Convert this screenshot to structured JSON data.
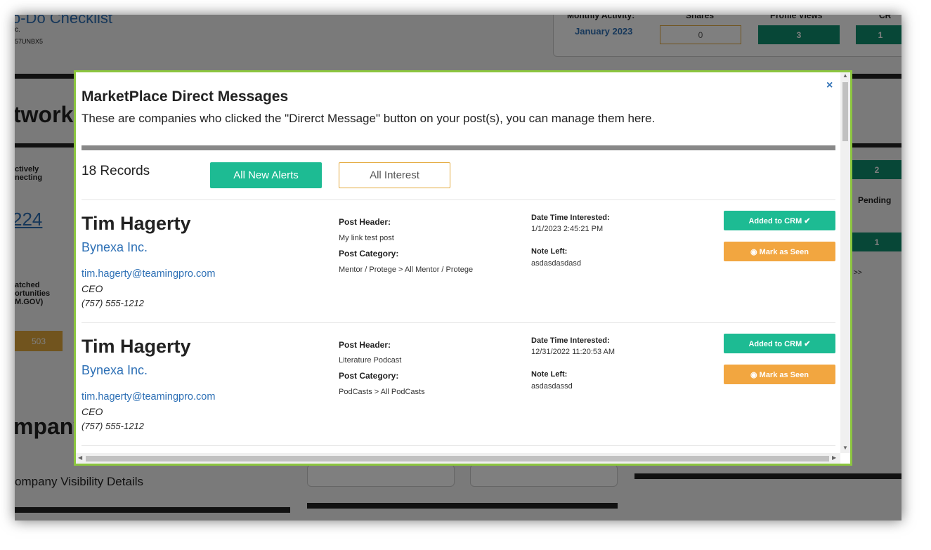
{
  "background": {
    "checklist_title": "o-Do Checklist",
    "company_fragment": "c.",
    "code_fragment": "57UNBX5",
    "monthly_activity_label": "Monthly Activity:",
    "month": "January 2023",
    "shares_label": "Shares",
    "profile_views_label": "Profile Views",
    "crm_label": "CR",
    "shares_value": "0",
    "profile_views_value": "3",
    "crm_value": "1",
    "networking_fragment": "tworki",
    "actively_connecting": "ctively\nnecting",
    "big_number": "224",
    "matched_opps": "atched\nortunities\nM.GOV)",
    "orange_value": "503",
    "company_fragment2": "mpany",
    "visibility_details": "ompany Visibility Details",
    "pending_label": "Pending",
    "right_green_1": "2",
    "right_green_2": "1",
    "arrows": ">>"
  },
  "modal": {
    "title": "MarketPlace Direct Messages",
    "subtitle": "These are companies who clicked the \"Direrct Message\" button on your post(s), you can manage them here.",
    "close_symbol": "×",
    "records_count": "18 Records",
    "tab_new_alerts": "All New Alerts",
    "tab_all_interest": "All Interest",
    "labels": {
      "post_header": "Post Header:",
      "post_category": "Post Category:",
      "date_time": "Date Time Interested:",
      "note_left": "Note Left:"
    },
    "records": [
      {
        "name": "Tim Hagerty",
        "company": "Bynexa Inc.",
        "email": "tim.hagerty@teamingpro.com",
        "title": "CEO",
        "phone": "(757) 555-1212",
        "post_header": "My link test post",
        "post_category": "Mentor / Protege > All Mentor / Protege",
        "date_time": "1/1/2023 2:45:21 PM",
        "note": "asdasdasdasd",
        "crm_button": "Added to CRM ✔",
        "seen_button": "◉ Mark as Seen"
      },
      {
        "name": "Tim Hagerty",
        "company": "Bynexa Inc.",
        "email": "tim.hagerty@teamingpro.com",
        "title": "CEO",
        "phone": "(757) 555-1212",
        "post_header": "Literature Podcast",
        "post_category": "PodCasts > All PodCasts",
        "date_time": "12/31/2022 11:20:53 AM",
        "note": "asdasdassd",
        "crm_button": "Added to CRM ✔",
        "seen_button": "◉ Mark as Seen"
      }
    ]
  },
  "colors": {
    "modal_border": "#8cc63f",
    "primary_green": "#1dbb93",
    "orange": "#f2a640",
    "link_blue": "#2c6fb5"
  }
}
